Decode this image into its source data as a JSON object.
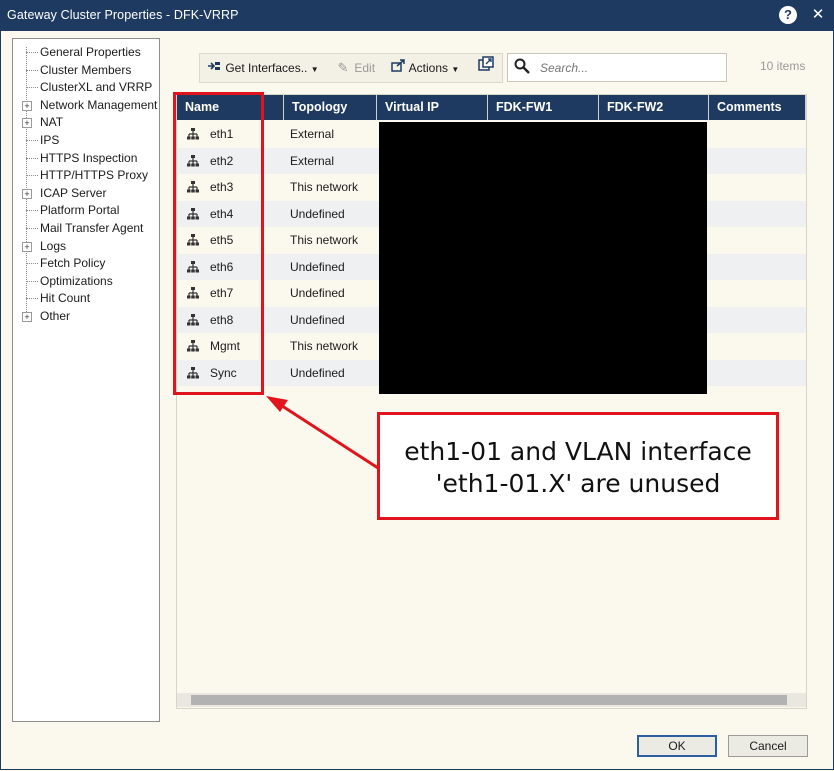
{
  "window": {
    "title": "Gateway Cluster Properties - DFK-VRRP",
    "help_label": "?",
    "close_label": "✕"
  },
  "tree": [
    {
      "label": "General Properties",
      "expandable": false
    },
    {
      "label": "Cluster Members",
      "expandable": false
    },
    {
      "label": "ClusterXL and VRRP",
      "expandable": false
    },
    {
      "label": "Network Management",
      "expandable": true
    },
    {
      "label": "NAT",
      "expandable": true
    },
    {
      "label": "IPS",
      "expandable": false
    },
    {
      "label": "HTTPS Inspection",
      "expandable": false
    },
    {
      "label": "HTTP/HTTPS Proxy",
      "expandable": false
    },
    {
      "label": "ICAP Server",
      "expandable": true
    },
    {
      "label": "Platform Portal",
      "expandable": false
    },
    {
      "label": "Mail Transfer Agent",
      "expandable": false
    },
    {
      "label": "Logs",
      "expandable": true
    },
    {
      "label": "Fetch Policy",
      "expandable": false
    },
    {
      "label": "Optimizations",
      "expandable": false
    },
    {
      "label": "Hit Count",
      "expandable": false
    },
    {
      "label": "Other",
      "expandable": true
    }
  ],
  "toolbar": {
    "get_interfaces": "Get Interfaces..",
    "edit": "Edit",
    "actions": "Actions",
    "search_placeholder": "Search...",
    "items_count": "10 items"
  },
  "grid": {
    "columns": [
      "Name",
      "Topology",
      "Virtual IP",
      "FDK-FW1",
      "FDK-FW2",
      "Comments"
    ],
    "rows": [
      {
        "name": "eth1",
        "topology": "External"
      },
      {
        "name": "eth2",
        "topology": "External"
      },
      {
        "name": "eth3",
        "topology": "This network"
      },
      {
        "name": "eth4",
        "topology": "Undefined"
      },
      {
        "name": "eth5",
        "topology": "This network"
      },
      {
        "name": "eth6",
        "topology": "Undefined"
      },
      {
        "name": "eth7",
        "topology": "Undefined"
      },
      {
        "name": "eth8",
        "topology": "Undefined"
      },
      {
        "name": "Mgmt",
        "topology": "This network"
      },
      {
        "name": "Sync",
        "topology": "Undefined"
      }
    ]
  },
  "callout": {
    "line1": "eth1-01 and VLAN interface",
    "line2": "'eth1-01.X' are unused"
  },
  "buttons": {
    "ok": "OK",
    "cancel": "Cancel"
  },
  "colors": {
    "titlebar": "#1f3a60",
    "annotation_red": "#e0141c",
    "background": "#fbf8ee"
  }
}
